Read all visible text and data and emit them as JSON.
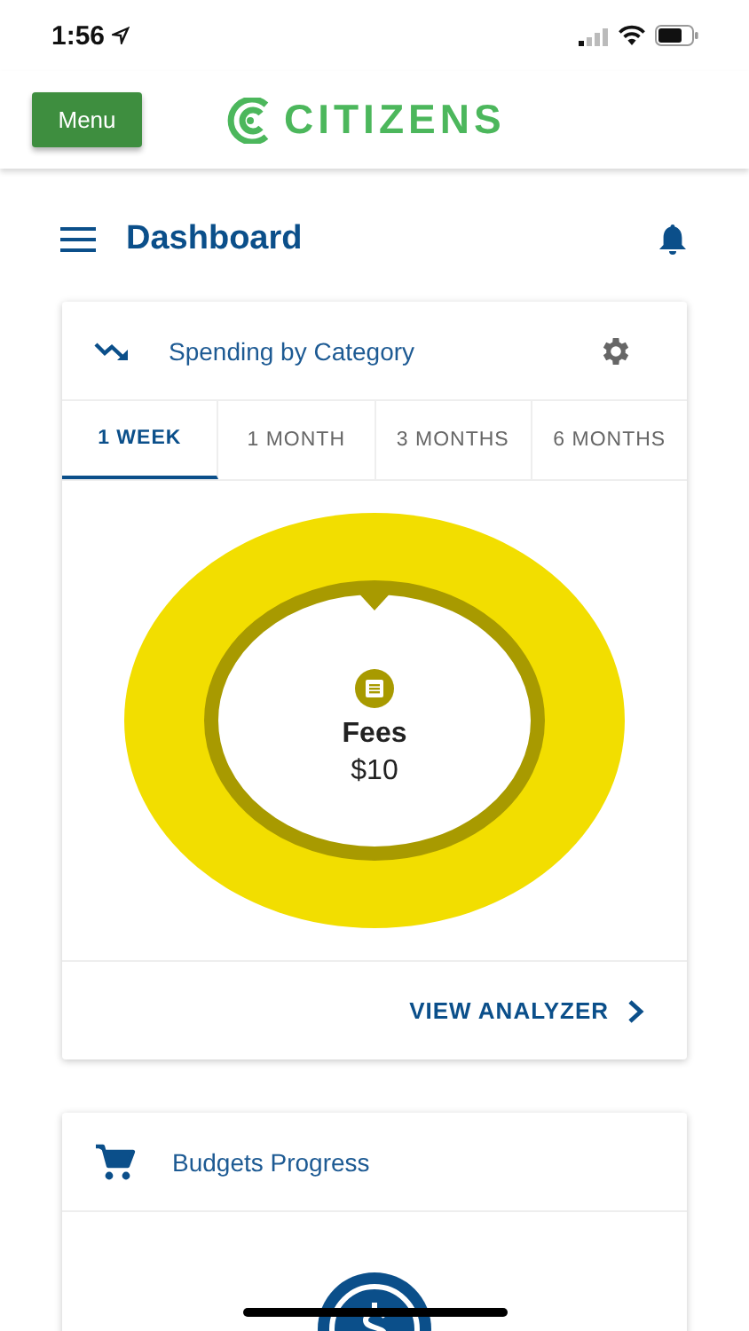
{
  "status_bar": {
    "time": "1:56"
  },
  "header": {
    "menu_button": "Menu",
    "logo": "CITIZENS"
  },
  "page": {
    "title": "Dashboard"
  },
  "spending_card": {
    "title": "Spending by Category",
    "tabs": [
      {
        "label": "1 WEEK",
        "selected": true
      },
      {
        "label": "1 MONTH",
        "selected": false
      },
      {
        "label": "3 MONTHS",
        "selected": false
      },
      {
        "label": "6 MONTHS",
        "selected": false
      }
    ],
    "donut": {
      "category": "Fees",
      "amount": "$10",
      "color": "#f2de00"
    },
    "link": "VIEW ANALYZER"
  },
  "budgets_card": {
    "title": "Budgets Progress"
  }
}
